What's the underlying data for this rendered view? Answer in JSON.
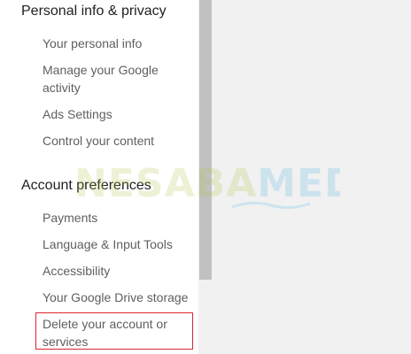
{
  "sidebar": {
    "section_personal": {
      "title": "Personal info & privacy",
      "items": [
        {
          "label": "Your personal info"
        },
        {
          "label": "Manage your Google activity"
        },
        {
          "label": "Ads Settings"
        },
        {
          "label": "Control your content"
        }
      ]
    },
    "section_account": {
      "title": "Account preferences",
      "items": [
        {
          "label": "Payments"
        },
        {
          "label": "Language & Input Tools"
        },
        {
          "label": "Accessibility"
        },
        {
          "label": "Your Google Drive storage"
        },
        {
          "label": "Delete your account or services"
        }
      ]
    }
  },
  "watermark": {
    "text": "NESABAMEDIA"
  },
  "colors": {
    "highlight": "#d9262f",
    "section_title": "#212121",
    "item_text": "#5f5f5f",
    "background": "#f1f1f1",
    "scroll_thumb": "#c1c1c1"
  }
}
